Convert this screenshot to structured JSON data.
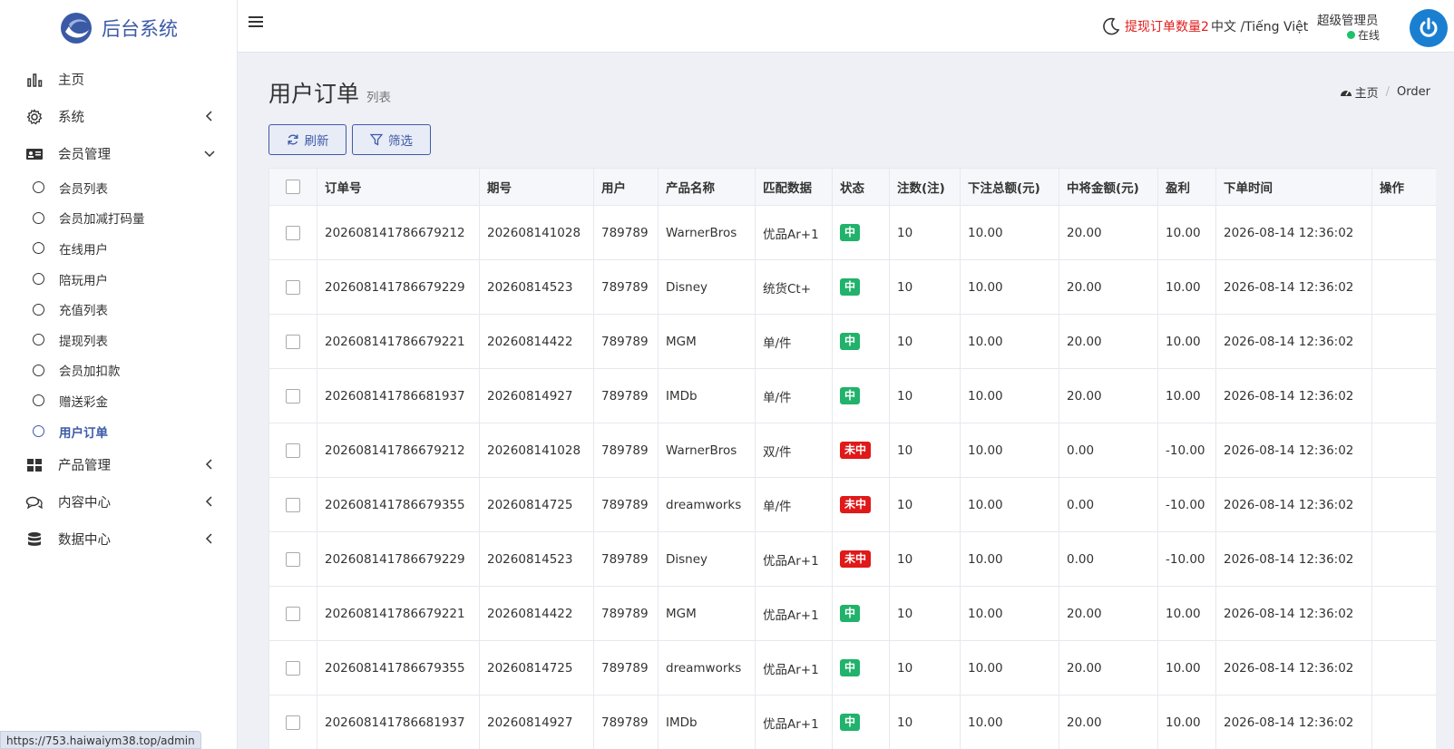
{
  "app": {
    "brand": "后台系统"
  },
  "sidebar": {
    "items": [
      {
        "label": "主页",
        "icon": "bar-chart-icon",
        "chevron": false
      },
      {
        "label": "系统",
        "icon": "gear-icon",
        "chevron": "left"
      },
      {
        "label": "会员管理",
        "icon": "id-card-icon",
        "chevron": "down"
      }
    ],
    "subitems": [
      {
        "label": "会员列表"
      },
      {
        "label": "会员加减打码量"
      },
      {
        "label": "在线用户"
      },
      {
        "label": "陪玩用户"
      },
      {
        "label": "充值列表"
      },
      {
        "label": "提现列表"
      },
      {
        "label": "会员加扣款"
      },
      {
        "label": "赠送彩金"
      },
      {
        "label": "用户订单",
        "active": true
      }
    ],
    "items_after": [
      {
        "label": "产品管理",
        "icon": "grid-icon"
      },
      {
        "label": "内容中心",
        "icon": "chat-icon"
      },
      {
        "label": "数据中心",
        "icon": "database-icon"
      }
    ]
  },
  "header": {
    "withdraw_alert": "提现订单数量2",
    "lang_switch": "中文 /Tiếng Việt",
    "user_name": "超级管理员",
    "user_status": "在线"
  },
  "page": {
    "title": "用户订单",
    "subtitle": "列表",
    "breadcrumb_home": "主页",
    "breadcrumb_current": "Order",
    "refresh_label": "刷新",
    "filter_label": "筛选"
  },
  "table": {
    "headers": [
      "订单号",
      "期号",
      "用户",
      "产品名称",
      "匹配数据",
      "状态",
      "注数(注)",
      "下注总额(元)",
      "中将金额(元)",
      "盈利",
      "下单时间",
      "操作"
    ],
    "rows": [
      {
        "order_no": "202608141786679212",
        "period": "202608141028",
        "user": "789789",
        "product": "WarnerBros",
        "match": "优品Ar+1",
        "status": "中",
        "win": true,
        "bets": "10",
        "bet_total": "10.00",
        "win_amount": "20.00",
        "profit": "10.00",
        "time": "2026-08-14 12:36:02"
      },
      {
        "order_no": "202608141786679229",
        "period": "20260814523",
        "user": "789789",
        "product": "Disney",
        "match": "统货Ct+",
        "status": "中",
        "win": true,
        "bets": "10",
        "bet_total": "10.00",
        "win_amount": "20.00",
        "profit": "10.00",
        "time": "2026-08-14 12:36:02"
      },
      {
        "order_no": "202608141786679221",
        "period": "20260814422",
        "user": "789789",
        "product": "MGM",
        "match": "单/件",
        "status": "中",
        "win": true,
        "bets": "10",
        "bet_total": "10.00",
        "win_amount": "20.00",
        "profit": "10.00",
        "time": "2026-08-14 12:36:02"
      },
      {
        "order_no": "202608141786681937",
        "period": "20260814927",
        "user": "789789",
        "product": "IMDb",
        "match": "单/件",
        "status": "中",
        "win": true,
        "bets": "10",
        "bet_total": "10.00",
        "win_amount": "20.00",
        "profit": "10.00",
        "time": "2026-08-14 12:36:02"
      },
      {
        "order_no": "202608141786679212",
        "period": "202608141028",
        "user": "789789",
        "product": "WarnerBros",
        "match": "双/件",
        "status": "未中",
        "win": false,
        "bets": "10",
        "bet_total": "10.00",
        "win_amount": "0.00",
        "profit": "-10.00",
        "time": "2026-08-14 12:36:02"
      },
      {
        "order_no": "202608141786679355",
        "period": "20260814725",
        "user": "789789",
        "product": "dreamworks",
        "match": "单/件",
        "status": "未中",
        "win": false,
        "bets": "10",
        "bet_total": "10.00",
        "win_amount": "0.00",
        "profit": "-10.00",
        "time": "2026-08-14 12:36:02"
      },
      {
        "order_no": "202608141786679229",
        "period": "20260814523",
        "user": "789789",
        "product": "Disney",
        "match": "优品Ar+1",
        "status": "未中",
        "win": false,
        "bets": "10",
        "bet_total": "10.00",
        "win_amount": "0.00",
        "profit": "-10.00",
        "time": "2026-08-14 12:36:02"
      },
      {
        "order_no": "202608141786679221",
        "period": "20260814422",
        "user": "789789",
        "product": "MGM",
        "match": "优品Ar+1",
        "status": "中",
        "win": true,
        "bets": "10",
        "bet_total": "10.00",
        "win_amount": "20.00",
        "profit": "10.00",
        "time": "2026-08-14 12:36:02"
      },
      {
        "order_no": "202608141786679355",
        "period": "20260814725",
        "user": "789789",
        "product": "dreamworks",
        "match": "优品Ar+1",
        "status": "中",
        "win": true,
        "bets": "10",
        "bet_total": "10.00",
        "win_amount": "20.00",
        "profit": "10.00",
        "time": "2026-08-14 12:36:02"
      },
      {
        "order_no": "202608141786681937",
        "period": "20260814927",
        "user": "789789",
        "product": "IMDb",
        "match": "优品Ar+1",
        "status": "中",
        "win": true,
        "bets": "10",
        "bet_total": "10.00",
        "win_amount": "20.00",
        "profit": "10.00",
        "time": "2026-08-14 12:36:02"
      }
    ]
  },
  "statusbar": {
    "url": "https://753.haiwaiym38.top/admin"
  },
  "colors": {
    "accent": "#3b5aa6",
    "win": "#21b26b",
    "lose": "#e01919",
    "alert": "#e21b1b",
    "online": "#1fc16b"
  }
}
